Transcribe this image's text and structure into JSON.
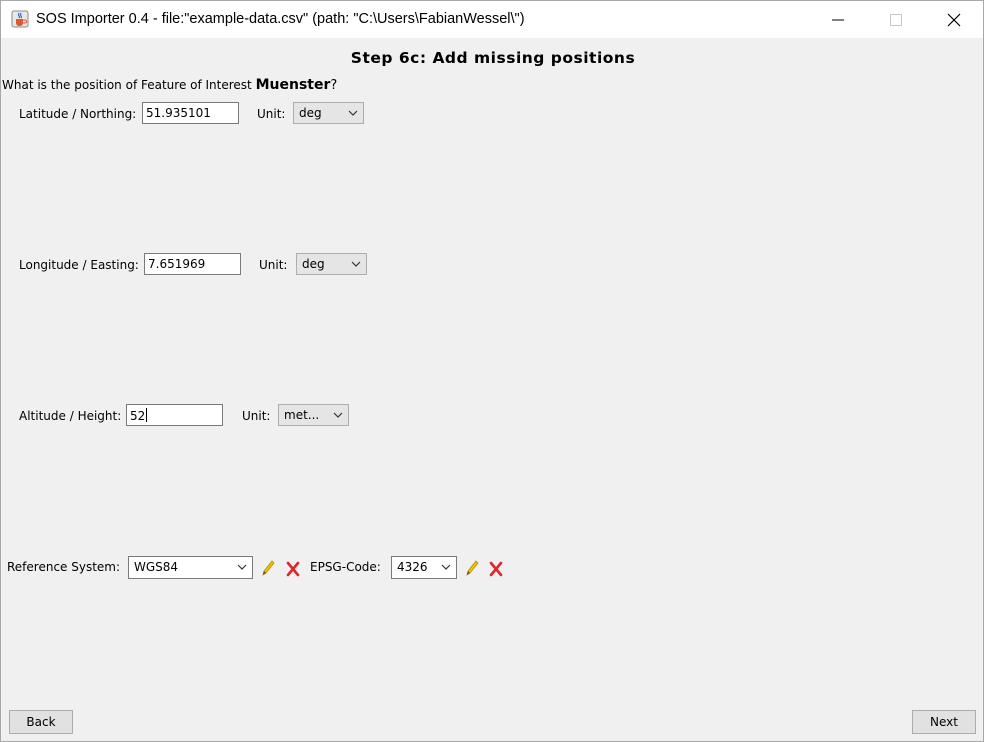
{
  "window": {
    "title": "SOS Importer 0.4 - file:\"example-data.csv\" (path: \"C:\\Users\\FabianWessel\\\")"
  },
  "step": {
    "title": "Step 6c: Add missing positions"
  },
  "question": {
    "text": "What is the position of Feature of Interest",
    "feature": "Muenster",
    "mark": "?"
  },
  "latitude": {
    "label": "Latitude / Northing:",
    "value": "51.935101",
    "unit_label": "Unit:",
    "unit": "deg"
  },
  "longitude": {
    "label": "Longitude / Easting:",
    "value": "7.651969",
    "unit_label": "Unit:",
    "unit": "deg"
  },
  "altitude": {
    "label": "Altitude / Height:",
    "value": "52",
    "unit_label": "Unit:",
    "unit": "met..."
  },
  "reference": {
    "label": "Reference System:",
    "value": "WGS84",
    "epsg_label": "EPSG-Code:",
    "epsg_value": "4326"
  },
  "nav": {
    "back": "Back",
    "next": "Next"
  },
  "icons": {
    "app": "java-cup-icon",
    "minimize": "minimize-icon",
    "maximize": "maximize-icon",
    "close": "close-icon",
    "edit": "pencil-icon",
    "delete": "red-x-icon",
    "dropdown": "chevron-down-icon"
  },
  "colors": {
    "delete": "#e0242b",
    "pencil": "#e8b800"
  }
}
